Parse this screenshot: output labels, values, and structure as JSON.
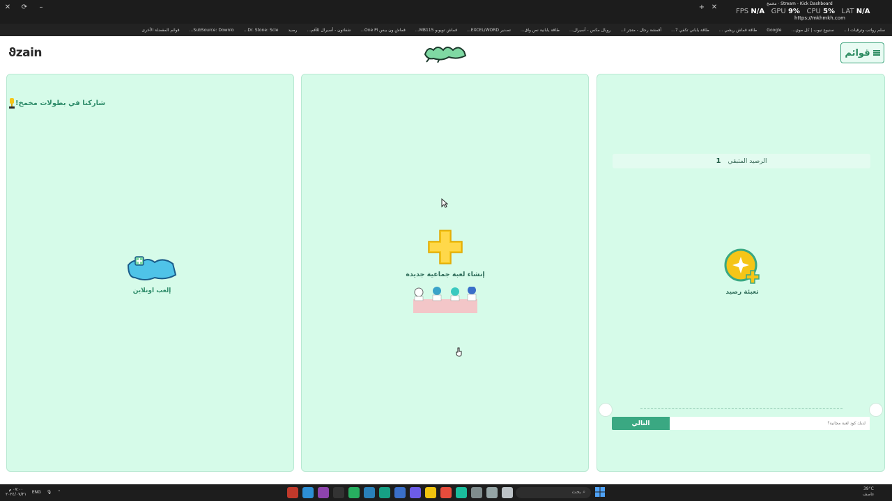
{
  "browser": {
    "tab_title": "Stream - Kick Dashboard",
    "tab_site": "مخمخ",
    "url": "https://mkhmkh.com",
    "bookmarks": [
      "سلم رواتب وترقيات ا...",
      "سنيوع نيوب | كل موي...",
      "Google",
      "طاقة قماش ريشي ...",
      "طاقة ياباني تكفي 7...",
      "أقمشة رجال - متجر ا...",
      "رويال مكس - أسيرال...",
      "طاقة يابانية نص واق...",
      "تصدير EXCEL/WORD...",
      "قماش تويوبو MB115...",
      "قماش ون بيس One Pi...",
      "شفاتون - أسيرال للأقم...",
      "رصيد",
      "Dr. Stone: Scie...",
      "SubSource: Downlo...",
      "قوائم المفضلة الأخرى"
    ],
    "overlay": {
      "fps_label": "FPS",
      "fps_value": "N/A",
      "gpu_label": "GPU",
      "gpu_value": "9%",
      "cpu_label": "CPU",
      "cpu_value": "5%",
      "lat_label": "LAT",
      "lat_value": "N/A"
    }
  },
  "header": {
    "brand": "zain",
    "menu_label": "قوائم"
  },
  "left_panel": {
    "tournament_text": "شاركنا في بطولات مخمخ!",
    "play_online_label": "إلعب اونلاين"
  },
  "middle_panel": {
    "create_game_label": "إنشاء لعبة جماعية جديدة"
  },
  "right_panel": {
    "balance_label": "الرصيد المتبقي",
    "balance_value": "1",
    "topup_label": "تعبئة رصيد",
    "next_button": "التالي",
    "code_placeholder": "لديك كود لعبة مجانية؟"
  },
  "taskbar": {
    "language": "ENG",
    "search_placeholder": "بحث",
    "time": "٠٧:٠٠ م",
    "date": "٢٠٢٤/٠٧/٢١",
    "weather_temp": "39°C",
    "weather_desc": "عاصف"
  },
  "colors": {
    "panel_bg": "#d6fbe9",
    "accent": "#3aa882",
    "plus_yellow": "#f5c518",
    "text_green": "#2f8c6a"
  }
}
